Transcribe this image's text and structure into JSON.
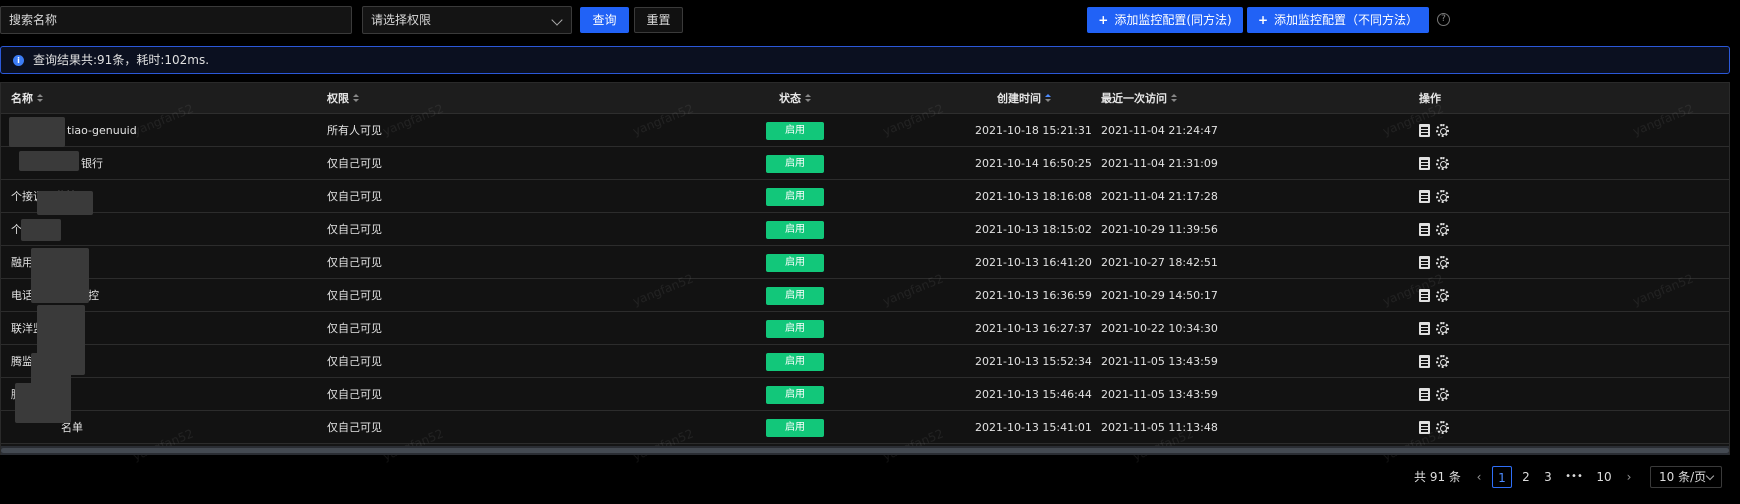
{
  "toolbar": {
    "search_placeholder": "搜索名称",
    "permission_placeholder": "请选择权限",
    "query_label": "查询",
    "reset_label": "重置",
    "add_same_label": "添加监控配置(同方法)",
    "add_diff_label": "添加监控配置（不同方法）",
    "help_symbol": "?"
  },
  "info": {
    "icon": "info-icon",
    "text": "查询结果共:91条，耗时:102ms."
  },
  "table": {
    "columns": {
      "name": "名称",
      "permission": "权限",
      "status": "状态",
      "created": "创建时间",
      "last_access": "最近一次访问",
      "actions": "操作"
    },
    "rows": [
      {
        "name": "tiao-genuuid",
        "permission": "所有人可见",
        "status": "启用",
        "created": "2021-10-18 15:21:31",
        "last_access": "2021-11-04 21:24:47"
      },
      {
        "name": "银行",
        "permission": "仅自己可见",
        "status": "启用",
        "created": "2021-10-14 16:50:25",
        "last_access": "2021-11-04 21:31:09"
      },
      {
        "name": "个接调用监控",
        "permission": "仅自己可见",
        "status": "启用",
        "created": "2021-10-13 18:16:08",
        "last_access": "2021-11-04 21:17:28"
      },
      {
        "name": "个",
        "permission": "仅自己可见",
        "status": "启用",
        "created": "2021-10-13 18:15:02",
        "last_access": "2021-10-29 11:39:56"
      },
      {
        "name": "融用监控",
        "permission": "仅自己可见",
        "status": "启用",
        "created": "2021-10-13 16:41:20",
        "last_access": "2021-10-27 18:42:51"
      },
      {
        "name": "电话等级调用监控",
        "permission": "仅自己可见",
        "status": "启用",
        "created": "2021-10-13 16:36:59",
        "last_access": "2021-10-29 14:50:17"
      },
      {
        "name": "联洋监控",
        "permission": "仅自己可见",
        "status": "启用",
        "created": "2021-10-13 16:27:37",
        "last_access": "2021-10-22 10:34:30"
      },
      {
        "name": "腾监控",
        "permission": "仅自己可见",
        "status": "启用",
        "created": "2021-10-13 15:52:34",
        "last_access": "2021-11-05 13:43:59"
      },
      {
        "name": "腾",
        "permission": "仅自己可见",
        "status": "启用",
        "created": "2021-10-13 15:46:44",
        "last_access": "2021-11-05 13:43:59"
      },
      {
        "name": "名单",
        "permission": "仅自己可见",
        "status": "启用",
        "created": "2021-10-13 15:41:01",
        "last_access": "2021-11-05 11:13:48"
      }
    ],
    "watermark": "yangfan52"
  },
  "pagination": {
    "total": "共 91 条",
    "prev": "‹",
    "pages": [
      "1",
      "2",
      "3"
    ],
    "ellipsis": "•••",
    "last_page": "10",
    "next": "›",
    "current": "1",
    "page_size": "10 条/页"
  },
  "colors": {
    "primary": "#2162f6",
    "status_enabled": "#12c77a",
    "info_border": "#2b58d8"
  }
}
